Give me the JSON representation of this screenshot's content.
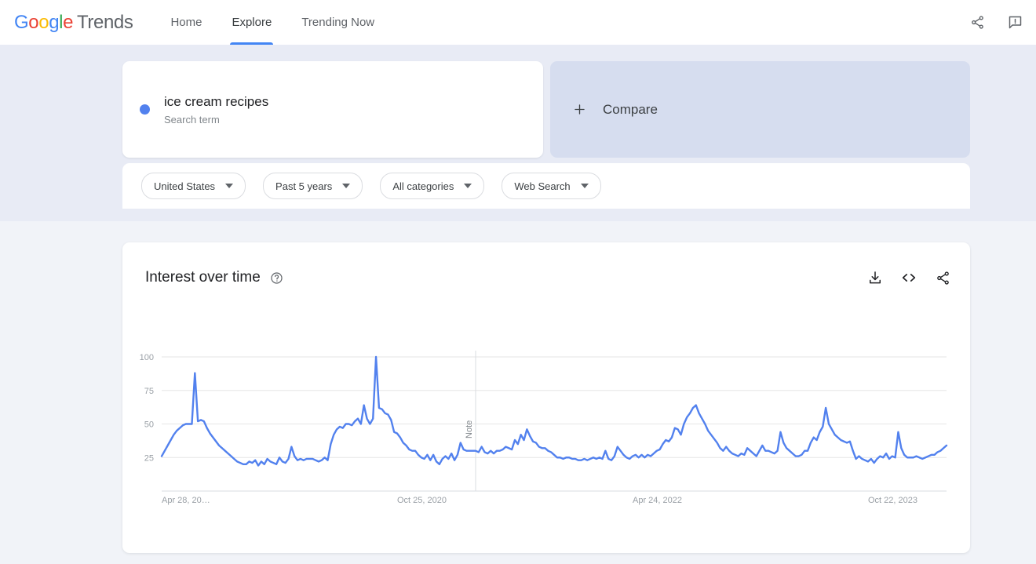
{
  "header": {
    "logo": {
      "word1": "Google",
      "word2": "Trends"
    },
    "nav": [
      {
        "label": "Home",
        "active": false
      },
      {
        "label": "Explore",
        "active": true
      },
      {
        "label": "Trending Now",
        "active": false
      }
    ],
    "icons": [
      {
        "name": "share-icon"
      },
      {
        "name": "feedback-icon"
      }
    ]
  },
  "query": {
    "term": {
      "title": "ice cream recipes",
      "subtitle": "Search term",
      "dot_color": "#5281ee"
    },
    "compare": {
      "label": "Compare",
      "plus": "+"
    }
  },
  "filters": [
    {
      "label": "United States"
    },
    {
      "label": "Past 5 years"
    },
    {
      "label": "All categories"
    },
    {
      "label": "Web Search"
    }
  ],
  "chart_card": {
    "title": "Interest over time",
    "help": "?",
    "actions": [
      {
        "name": "download-icon"
      },
      {
        "name": "embed-code-icon"
      },
      {
        "name": "share-icon"
      }
    ]
  },
  "chart_data": {
    "type": "line",
    "title": "Interest over time",
    "xlabel": "",
    "ylabel": "",
    "ylim": [
      0,
      100
    ],
    "yticks": [
      25,
      50,
      75,
      100
    ],
    "grid": true,
    "legend": false,
    "line_color": "#5281ee",
    "annotations": [
      {
        "label": "Note",
        "x_index": 104,
        "orientation": "vertical"
      }
    ],
    "xticks": [
      {
        "index": 0,
        "label": "Apr 28, 20…"
      },
      {
        "index": 78,
        "label": "Oct 25, 2020"
      },
      {
        "index": 156,
        "label": "Apr 24, 2022"
      },
      {
        "index": 234,
        "label": "Oct 22, 2023"
      }
    ],
    "categories": [
      "Apr 28, 2019",
      "May 5, 2019",
      "May 12, 2019",
      "May 19, 2019",
      "May 26, 2019",
      "Jun 2, 2019",
      "Jun 9, 2019",
      "Jun 16, 2019",
      "Jun 23, 2019",
      "Jun 30, 2019",
      "Jul 7, 2019",
      "Jul 14, 2019",
      "Jul 21, 2019",
      "Jul 28, 2019",
      "Aug 4, 2019",
      "Aug 11, 2019",
      "Aug 18, 2019",
      "Aug 25, 2019",
      "Sep 1, 2019",
      "Sep 8, 2019",
      "Sep 15, 2019",
      "Sep 22, 2019",
      "Sep 29, 2019",
      "Oct 6, 2019",
      "Oct 13, 2019",
      "Oct 20, 2019",
      "Oct 27, 2019",
      "Nov 3, 2019",
      "Nov 10, 2019",
      "Nov 17, 2019",
      "Nov 24, 2019",
      "Dec 1, 2019",
      "Dec 8, 2019",
      "Dec 15, 2019",
      "Dec 22, 2019",
      "Dec 29, 2019",
      "Jan 5, 2020",
      "Jan 12, 2020",
      "Jan 19, 2020",
      "Jan 26, 2020",
      "Feb 2, 2020",
      "Feb 9, 2020",
      "Feb 16, 2020",
      "Feb 23, 2020",
      "Mar 1, 2020",
      "Mar 8, 2020",
      "Mar 15, 2020",
      "Mar 22, 2020",
      "Mar 29, 2020",
      "Apr 5, 2020",
      "Apr 12, 2020",
      "Apr 19, 2020",
      "Apr 26, 2020",
      "May 3, 2020",
      "May 10, 2020",
      "May 17, 2020",
      "May 24, 2020",
      "May 31, 2020",
      "Jun 7, 2020",
      "Jun 14, 2020",
      "Jun 21, 2020",
      "Jun 28, 2020",
      "Jul 5, 2020",
      "Jul 12, 2020",
      "Jul 19, 2020",
      "Jul 26, 2020",
      "Aug 2, 2020",
      "Aug 9, 2020",
      "Aug 16, 2020",
      "Aug 23, 2020",
      "Aug 30, 2020",
      "Sep 6, 2020",
      "Sep 13, 2020",
      "Sep 20, 2020",
      "Sep 27, 2020",
      "Oct 4, 2020",
      "Oct 11, 2020",
      "Oct 18, 2020",
      "Oct 25, 2020",
      "Nov 1, 2020",
      "Nov 8, 2020",
      "Nov 15, 2020",
      "Nov 22, 2020",
      "Nov 29, 2020",
      "Dec 6, 2020",
      "Dec 13, 2020",
      "Dec 20, 2020",
      "Dec 27, 2020",
      "Jan 3, 2021",
      "Jan 10, 2021",
      "Jan 17, 2021",
      "Jan 24, 2021",
      "Jan 31, 2021",
      "Feb 7, 2021",
      "Feb 14, 2021",
      "Feb 21, 2021",
      "Feb 28, 2021",
      "Mar 7, 2021",
      "Mar 14, 2021",
      "Mar 21, 2021",
      "Mar 28, 2021",
      "Apr 4, 2021",
      "Apr 11, 2021",
      "Apr 18, 2021",
      "Apr 25, 2021",
      "May 2, 2021",
      "May 9, 2021",
      "May 16, 2021",
      "May 23, 2021",
      "May 30, 2021",
      "Jun 6, 2021",
      "Jun 13, 2021",
      "Jun 20, 2021",
      "Jun 27, 2021",
      "Jul 4, 2021",
      "Jul 11, 2021",
      "Jul 18, 2021",
      "Jul 25, 2021",
      "Aug 1, 2021",
      "Aug 8, 2021",
      "Aug 15, 2021",
      "Aug 22, 2021",
      "Aug 29, 2021",
      "Sep 5, 2021",
      "Sep 12, 2021",
      "Sep 19, 2021",
      "Sep 26, 2021",
      "Oct 3, 2021",
      "Oct 10, 2021",
      "Oct 17, 2021",
      "Oct 24, 2021",
      "Oct 31, 2021",
      "Nov 7, 2021",
      "Nov 14, 2021",
      "Nov 21, 2021",
      "Nov 28, 2021",
      "Dec 5, 2021",
      "Dec 12, 2021",
      "Dec 19, 2021",
      "Dec 26, 2021",
      "Jan 2, 2022",
      "Jan 9, 2022",
      "Jan 16, 2022",
      "Jan 23, 2022",
      "Jan 30, 2022",
      "Feb 6, 2022",
      "Feb 13, 2022",
      "Feb 20, 2022",
      "Feb 27, 2022",
      "Mar 6, 2022",
      "Mar 13, 2022",
      "Mar 20, 2022",
      "Mar 27, 2022",
      "Apr 3, 2022",
      "Apr 10, 2022",
      "Apr 17, 2022",
      "Apr 24, 2022",
      "May 1, 2022",
      "May 8, 2022",
      "May 15, 2022",
      "May 22, 2022",
      "May 29, 2022",
      "Jun 5, 2022",
      "Jun 12, 2022",
      "Jun 19, 2022",
      "Jun 26, 2022",
      "Jul 3, 2022",
      "Jul 10, 2022",
      "Jul 17, 2022",
      "Jul 24, 2022",
      "Jul 31, 2022",
      "Aug 7, 2022",
      "Aug 14, 2022",
      "Aug 21, 2022",
      "Aug 28, 2022",
      "Sep 4, 2022",
      "Sep 11, 2022",
      "Sep 18, 2022",
      "Sep 25, 2022",
      "Oct 2, 2022",
      "Oct 9, 2022",
      "Oct 16, 2022",
      "Oct 23, 2022",
      "Oct 30, 2022",
      "Nov 6, 2022",
      "Nov 13, 2022",
      "Nov 20, 2022",
      "Nov 27, 2022",
      "Dec 4, 2022",
      "Dec 11, 2022",
      "Dec 18, 2022",
      "Dec 25, 2022",
      "Jan 1, 2023",
      "Jan 8, 2023",
      "Jan 15, 2023",
      "Jan 22, 2023",
      "Jan 29, 2023",
      "Feb 5, 2023",
      "Feb 12, 2023",
      "Feb 19, 2023",
      "Feb 26, 2023",
      "Mar 5, 2023",
      "Mar 12, 2023",
      "Mar 19, 2023",
      "Mar 26, 2023",
      "Apr 2, 2023",
      "Apr 9, 2023",
      "Apr 16, 2023",
      "Apr 23, 2023",
      "Apr 30, 2023",
      "May 7, 2023",
      "May 14, 2023",
      "May 21, 2023",
      "May 28, 2023",
      "Jun 4, 2023",
      "Jun 11, 2023",
      "Jun 18, 2023",
      "Jun 25, 2023",
      "Jul 2, 2023",
      "Jul 9, 2023",
      "Jul 16, 2023",
      "Jul 23, 2023",
      "Jul 30, 2023",
      "Aug 6, 2023",
      "Aug 13, 2023",
      "Aug 20, 2023",
      "Aug 27, 2023",
      "Sep 3, 2023",
      "Sep 10, 2023",
      "Sep 17, 2023",
      "Sep 24, 2023",
      "Oct 1, 2023",
      "Oct 8, 2023",
      "Oct 15, 2023",
      "Oct 22, 2023",
      "Oct 29, 2023",
      "Nov 5, 2023",
      "Nov 12, 2023",
      "Nov 19, 2023",
      "Nov 26, 2023",
      "Dec 3, 2023",
      "Dec 10, 2023",
      "Dec 17, 2023",
      "Dec 24, 2023",
      "Dec 31, 2023",
      "Jan 7, 2024",
      "Jan 14, 2024",
      "Jan 21, 2024",
      "Jan 28, 2024",
      "Feb 4, 2024",
      "Feb 11, 2024",
      "Feb 18, 2024",
      "Feb 25, 2024",
      "Mar 3, 2024",
      "Mar 10, 2024",
      "Mar 17, 2024",
      "Mar 24, 2024",
      "Mar 31, 2024",
      "Apr 7, 2024",
      "Apr 14, 2024",
      "Apr 21, 2024"
    ],
    "values": [
      26,
      30,
      34,
      38,
      42,
      45,
      47,
      49,
      50,
      50,
      50,
      88,
      52,
      53,
      52,
      47,
      43,
      40,
      37,
      34,
      32,
      30,
      28,
      26,
      24,
      22,
      21,
      20,
      20,
      22,
      21,
      23,
      19,
      22,
      20,
      24,
      22,
      21,
      20,
      25,
      22,
      21,
      24,
      33,
      26,
      23,
      24,
      23,
      24,
      24,
      24,
      23,
      22,
      23,
      25,
      23,
      35,
      42,
      46,
      48,
      47,
      50,
      50,
      49,
      52,
      54,
      50,
      64,
      54,
      50,
      54,
      100,
      62,
      61,
      58,
      57,
      53,
      44,
      43,
      40,
      36,
      34,
      31,
      30,
      30,
      27,
      25,
      24,
      27,
      23,
      27,
      22,
      20,
      24,
      26,
      24,
      28,
      23,
      27,
      36,
      31,
      30,
      30,
      30,
      30,
      29,
      33,
      29,
      28,
      30,
      28,
      30,
      30,
      31,
      33,
      32,
      31,
      38,
      35,
      42,
      38,
      46,
      41,
      37,
      36,
      33,
      32,
      32,
      30,
      29,
      27,
      25,
      25,
      24,
      25,
      25,
      24,
      24,
      23,
      23,
      24,
      23,
      24,
      25,
      24,
      25,
      24,
      30,
      24,
      23,
      26,
      33,
      30,
      27,
      25,
      24,
      26,
      27,
      25,
      27,
      25,
      27,
      26,
      28,
      30,
      31,
      35,
      38,
      37,
      40,
      47,
      46,
      42,
      50,
      55,
      58,
      62,
      64,
      58,
      54,
      50,
      45,
      42,
      39,
      36,
      32,
      30,
      33,
      30,
      28,
      27,
      26,
      28,
      27,
      32,
      30,
      28,
      26,
      30,
      34,
      30,
      30,
      29,
      28,
      30,
      44,
      36,
      32,
      30,
      28,
      26,
      26,
      27,
      30,
      30,
      36,
      40,
      38,
      44,
      48,
      62,
      50,
      46,
      42,
      40,
      38,
      37,
      36,
      37,
      30,
      24,
      26,
      24,
      23,
      22,
      24,
      21,
      24,
      26,
      25,
      28,
      24,
      26,
      25,
      44,
      32,
      27,
      25,
      25,
      25,
      26,
      25,
      24,
      25,
      26,
      27,
      27,
      29,
      30,
      32,
      34
    ]
  }
}
